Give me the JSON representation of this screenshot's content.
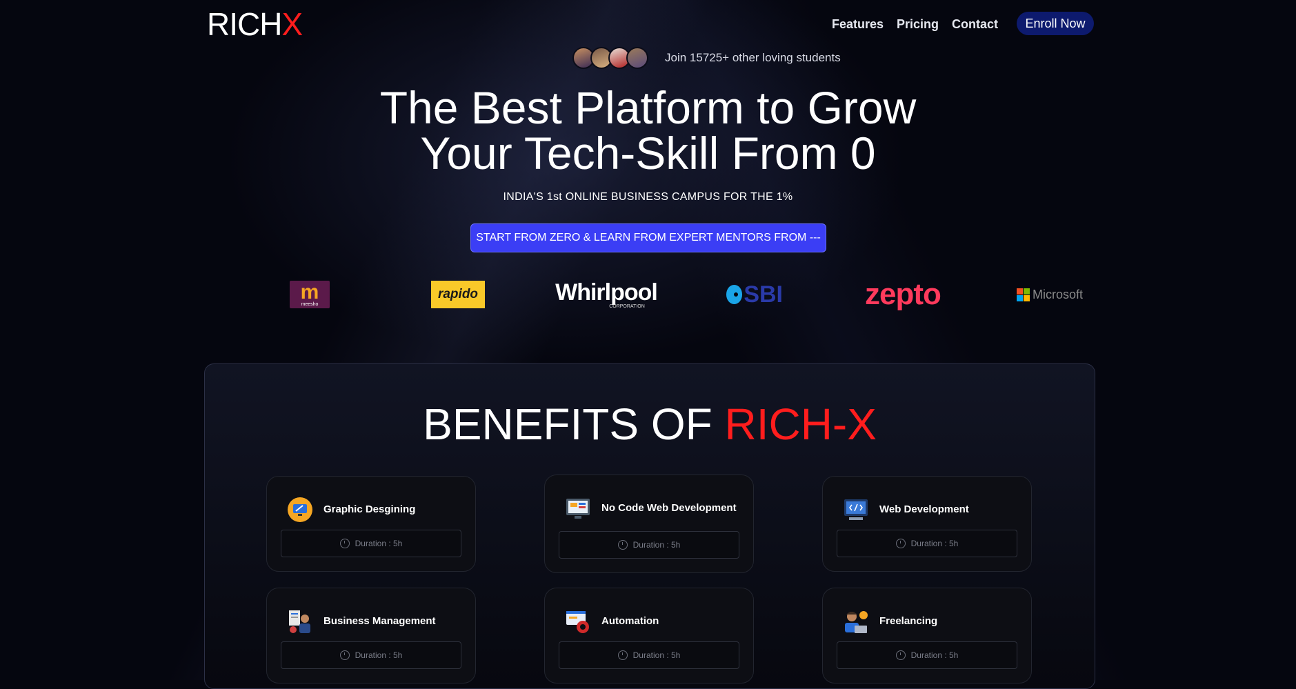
{
  "brand": {
    "logo_main": "RICH",
    "logo_accent": "X"
  },
  "nav": {
    "links": [
      "Features",
      "Pricing",
      "Contact"
    ],
    "enroll_label": "Enroll Now"
  },
  "hero": {
    "join_text": "Join 15725+ other loving students",
    "title_line1": "The Best Platform to Grow",
    "title_line2": "Your Tech-Skill From 0",
    "tagline": "INDIA'S 1st ONLINE BUSINESS CAMPUS FOR THE 1%",
    "cta_label": "START FROM ZERO & LEARN FROM EXPERT MENTORS FROM ---"
  },
  "partners": {
    "meesho": "m",
    "meesho_sub": "meesho",
    "rapido": "rapido",
    "whirlpool": "Whirlpool",
    "whirlpool_sub": "CORPORATION",
    "sbi": "SBI",
    "zepto": "zepto",
    "microsoft": "Microsoft"
  },
  "benefits": {
    "title_main": "BENEFITS OF ",
    "title_accent": "RICH-X",
    "accent_color": "#ff1d1d",
    "duration_label": "Duration : 5h",
    "courses": [
      {
        "title": "Graphic Desgining",
        "icon": "graphic-design-icon"
      },
      {
        "title": "No Code Web Development",
        "icon": "no-code-icon"
      },
      {
        "title": "Web Development",
        "icon": "web-dev-icon"
      },
      {
        "title": "Business Management",
        "icon": "business-icon"
      },
      {
        "title": "Automation",
        "icon": "automation-icon"
      },
      {
        "title": "Freelancing",
        "icon": "freelancing-icon"
      }
    ]
  }
}
